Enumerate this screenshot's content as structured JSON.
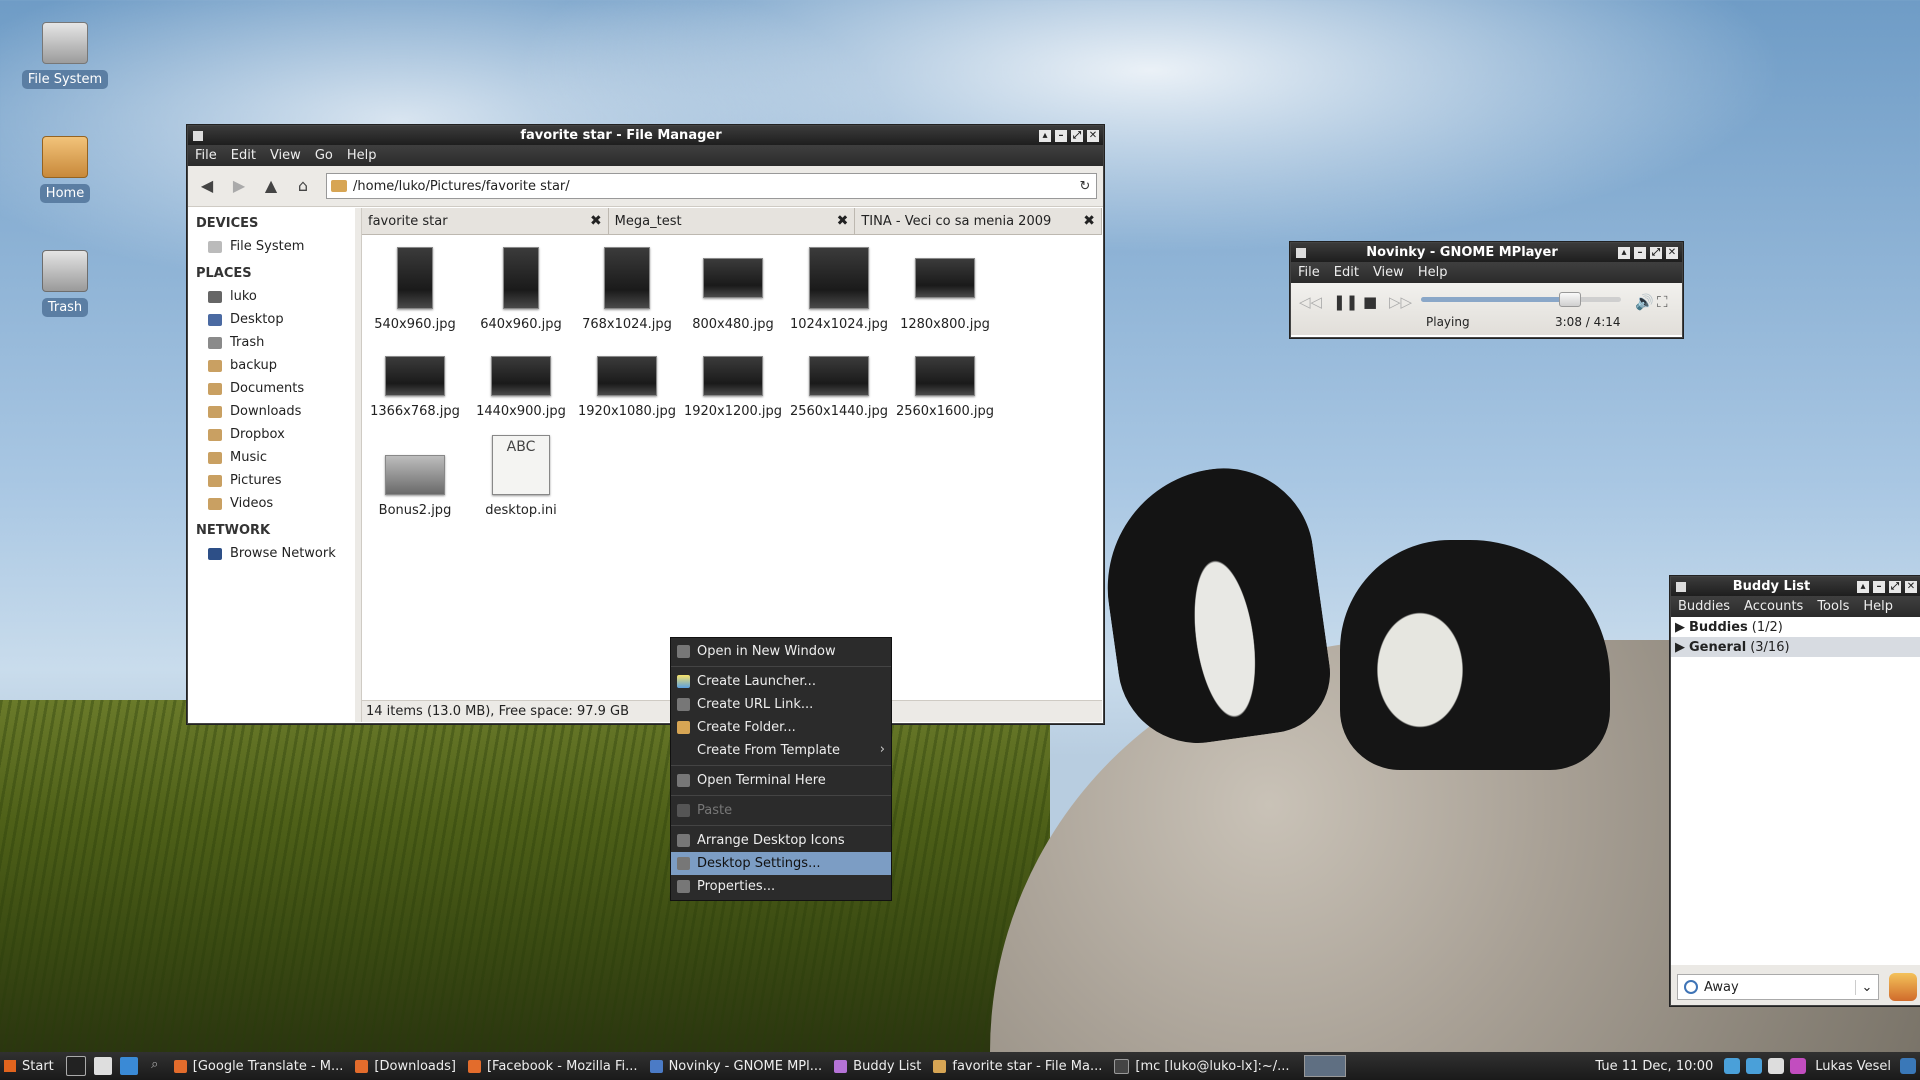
{
  "desktop": {
    "icons": [
      {
        "label": "File System",
        "icon": "drive-icon"
      },
      {
        "label": "Home",
        "icon": "home-folder-icon"
      },
      {
        "label": "Trash",
        "icon": "trash-icon"
      }
    ]
  },
  "file_manager": {
    "title": "favorite star - File Manager",
    "menu": [
      "File",
      "Edit",
      "View",
      "Go",
      "Help"
    ],
    "path": "/home/luko/Pictures/favorite star/",
    "sidebar": {
      "devices_heading": "DEVICES",
      "devices": [
        "File System"
      ],
      "places_heading": "PLACES",
      "places": [
        "luko",
        "Desktop",
        "Trash",
        "backup",
        "Documents",
        "Downloads",
        "Dropbox",
        "Music",
        "Pictures",
        "Videos"
      ],
      "network_heading": "NETWORK",
      "network": [
        "Browse Network"
      ]
    },
    "tabs": [
      "favorite star",
      "Mega_test",
      "TINA - Veci co sa menia 2009"
    ],
    "files": [
      "540x960.jpg",
      "640x960.jpg",
      "768x1024.jpg",
      "800x480.jpg",
      "1024x1024.jpg",
      "1280x800.jpg",
      "1366x768.jpg",
      "1440x900.jpg",
      "1920x1080.jpg",
      "1920x1200.jpg",
      "2560x1440.jpg",
      "2560x1600.jpg",
      "Bonus2.jpg",
      "desktop.ini"
    ],
    "ini_thumb_text": "ABC",
    "status": "14 items (13.0 MB), Free space: 97.9 GB"
  },
  "context_menu": {
    "items": [
      "Open in New Window",
      "Create Launcher...",
      "Create URL Link...",
      "Create Folder...",
      "Create From Template",
      "Open Terminal Here",
      "Paste",
      "Arrange Desktop Icons",
      "Desktop Settings...",
      "Properties..."
    ],
    "highlighted": "Desktop Settings...",
    "disabled": "Paste"
  },
  "mplayer": {
    "title": "Novinky - GNOME MPlayer",
    "menu": [
      "File",
      "Edit",
      "View",
      "Help"
    ],
    "status": "Playing",
    "time": "3:08 /  4:14",
    "progress": 0.74
  },
  "buddy_list": {
    "title": "Buddy List",
    "menu": [
      "Buddies",
      "Accounts",
      "Tools",
      "Help"
    ],
    "groups": [
      {
        "name": "Buddies",
        "count": "(1/2)"
      },
      {
        "name": "General",
        "count": "(3/16)"
      }
    ],
    "status": "Away"
  },
  "taskbar": {
    "start": "Start",
    "tasks": [
      "[Google Translate - M...",
      "[Downloads]",
      "[Facebook - Mozilla Fi...",
      "Novinky - GNOME MPl...",
      "Buddy List",
      "favorite star - File Ma...",
      "[mc [luko@luko-lx]:~/..."
    ],
    "clock": "Tue   11 Dec, 10:00",
    "user": "Lukas Vesel"
  }
}
